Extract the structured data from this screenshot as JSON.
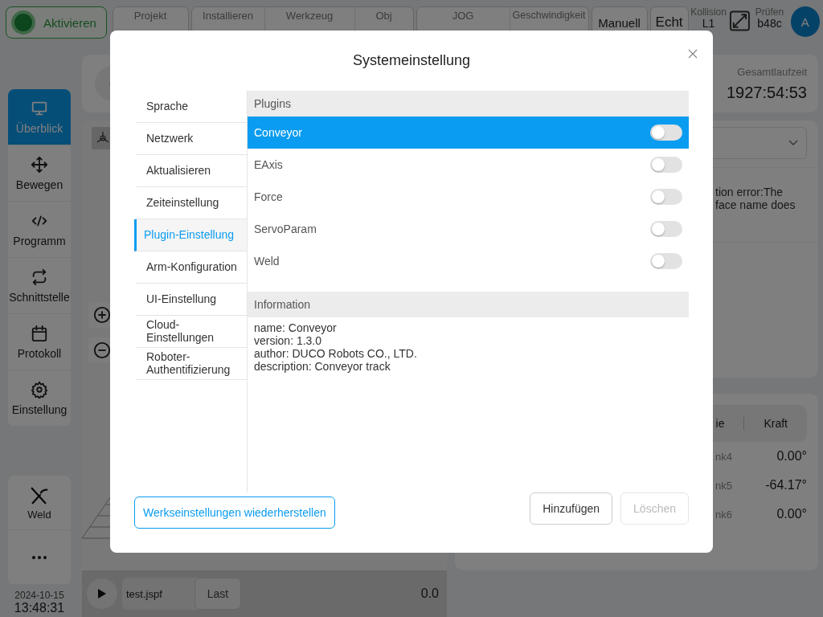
{
  "top_bar": {
    "activate_button": "Aktivieren",
    "groups": [
      {
        "cells": [
          "Projekt"
        ]
      },
      {
        "cells": [
          "Installieren",
          "Werkzeug",
          "Obj"
        ]
      },
      {
        "cells": [
          "JOG",
          "Geschwindigkeit"
        ]
      }
    ],
    "mode_buttons": [
      "Manuell",
      "Echt"
    ],
    "collision": {
      "label": "Kollision",
      "value": "L1"
    },
    "check": {
      "label": "Prüfen",
      "value": "b48c"
    },
    "avatar": "A"
  },
  "sidebar": {
    "items": [
      {
        "label": "Überblick",
        "kind": "monitor",
        "selected": true
      },
      {
        "label": "Bewegen",
        "kind": "move",
        "selected": false
      },
      {
        "label": "Programm",
        "kind": "code",
        "selected": false
      },
      {
        "label": "Schnittstelle",
        "kind": "repeat",
        "selected": false
      },
      {
        "label": "Protokoll",
        "kind": "calendar",
        "selected": false
      },
      {
        "label": "Einstellung",
        "kind": "gear",
        "selected": false
      }
    ],
    "extra_items": [
      {
        "label": "Weld",
        "kind": "weld"
      },
      {
        "kind": "more"
      }
    ],
    "date": "2024-10-15",
    "time": "13:48:31"
  },
  "program_bar": {
    "file": "test.jspf",
    "last_button": "Last",
    "value": "0.0"
  },
  "runtime": {
    "label": "Gesamtlaufzeit",
    "value": "1927:54:53"
  },
  "message": {
    "lines": [
      "tion error:The",
      "face name does"
    ]
  },
  "joint_panel": {
    "tabs": [
      "ie",
      "Kraft"
    ],
    "rows": [
      {
        "name": "nk4",
        "value": "0.00°"
      },
      {
        "name": "nk5",
        "value": "-64.17°"
      },
      {
        "name": "nk6",
        "value": "0.00°"
      }
    ]
  },
  "dialog": {
    "title": "Systemeinstellung",
    "nav": [
      {
        "label": "Sprache",
        "selected": false
      },
      {
        "label": "Netzwerk",
        "selected": false
      },
      {
        "label": "Aktualisieren",
        "selected": false
      },
      {
        "label": "Zeiteinstellung",
        "selected": false
      },
      {
        "label": "Plugin-Einstellung",
        "selected": true
      },
      {
        "label": "Arm-Konfiguration",
        "selected": false
      },
      {
        "label": "UI-Einstellung",
        "selected": false
      },
      {
        "label": "Cloud-Einstellungen",
        "selected": false
      },
      {
        "label": "Roboter-Authentifizierung",
        "selected": false
      }
    ],
    "plugins_header": "Plugins",
    "plugins": [
      {
        "name": "Conveyor",
        "selected": true,
        "on": false
      },
      {
        "name": "EAxis",
        "selected": false,
        "on": false
      },
      {
        "name": "Force",
        "selected": false,
        "on": false
      },
      {
        "name": "ServoParam",
        "selected": false,
        "on": false
      },
      {
        "name": "Weld",
        "selected": false,
        "on": false
      }
    ],
    "info_header": "Information",
    "info_lines": [
      "name: Conveyor",
      "version: 1.3.0",
      "author: DUCO Robots CO., LTD.",
      "description: Conveyor track"
    ],
    "reset_button": "Werkseinstellungen wiederherstellen",
    "buttons": [
      {
        "label": "Hinzufügen",
        "disabled": false
      },
      {
        "label": "Löschen",
        "disabled": true
      }
    ]
  }
}
